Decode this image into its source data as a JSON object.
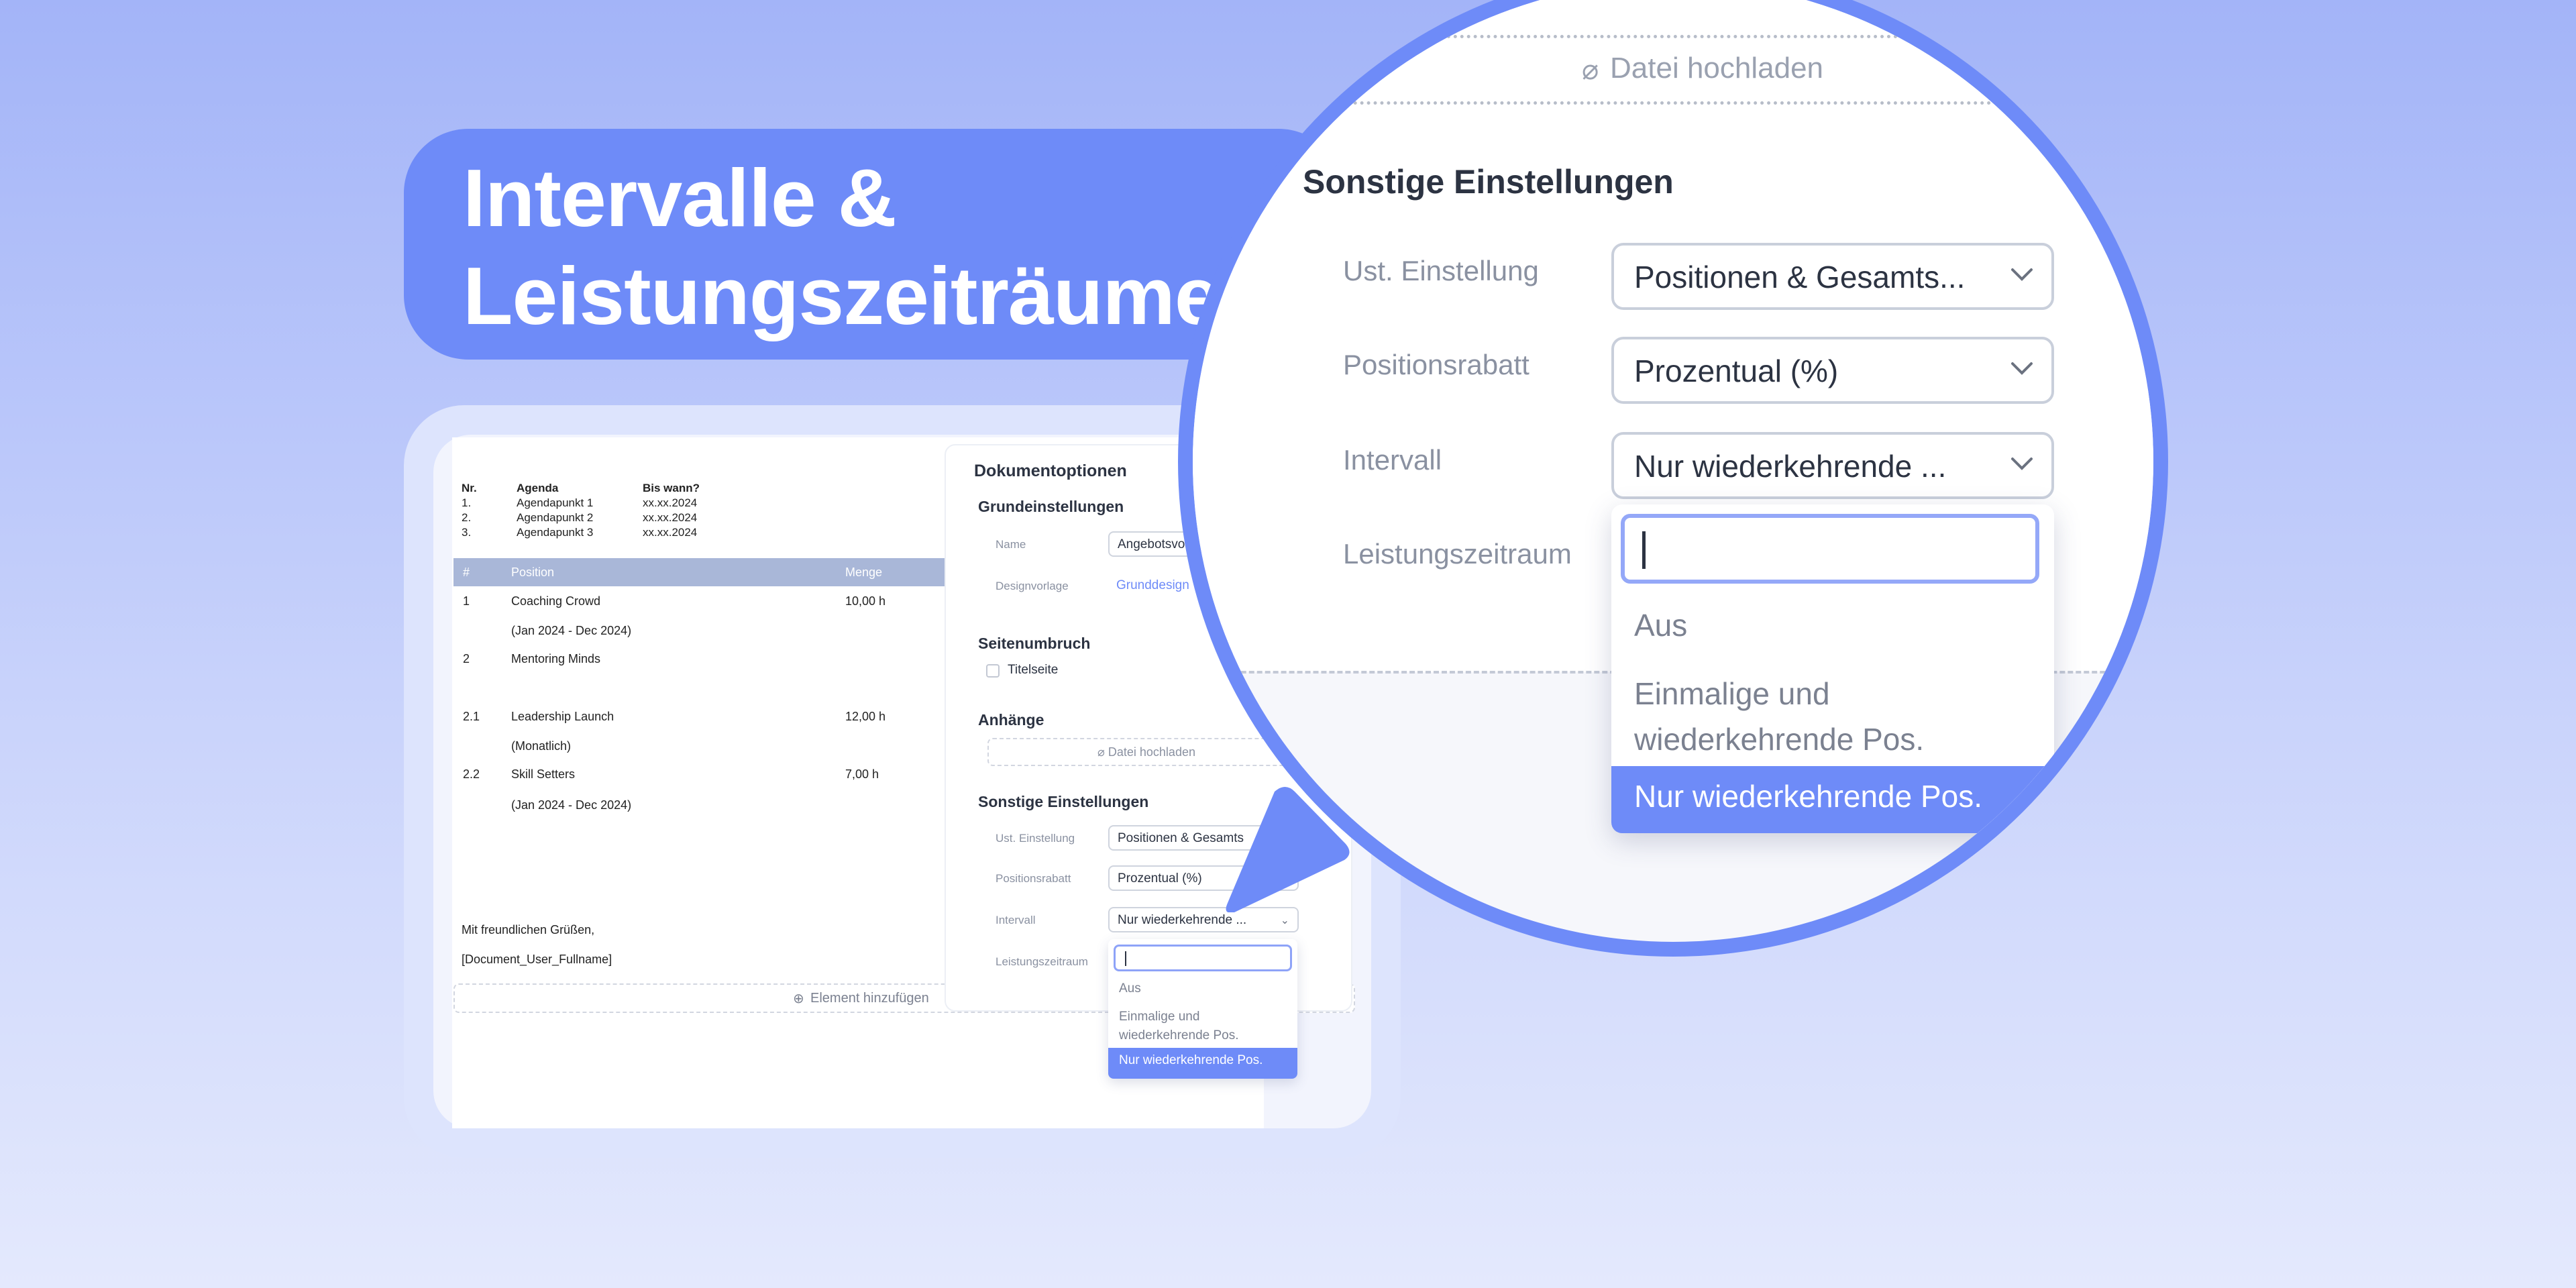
{
  "banner": {
    "title_line1": "Intervalle &",
    "title_line2": "Leistungszeiträume"
  },
  "document": {
    "agenda": {
      "headers": [
        "Nr.",
        "Agenda",
        "Bis wann?"
      ],
      "rows": [
        [
          "1.",
          "Agendapunkt 1",
          "xx.xx.2024"
        ],
        [
          "2.",
          "Agendapunkt 2",
          "xx.xx.2024"
        ],
        [
          "3.",
          "Agendapunkt 3",
          "xx.xx.2024"
        ]
      ]
    },
    "table_headers": [
      "#",
      "Position",
      "Menge"
    ],
    "rows": [
      {
        "nr": "1",
        "position": "Coaching Crowd",
        "menge": "10,00 h",
        "note": "(Jan 2024 - Dec 2024)"
      },
      {
        "nr": "2",
        "position": "Mentoring Minds",
        "menge": "",
        "note": ""
      },
      {
        "nr": "2.1",
        "position": "Leadership Launch",
        "menge": "12,00 h",
        "note": "(Monatlich)"
      },
      {
        "nr": "2.2",
        "position": "Skill Setters",
        "menge": "7,00 h",
        "note": "(Jan 2024 - Dec 2024)"
      }
    ],
    "closing": "Mit freundlichen Grüßen,",
    "signature": "[Document_User_Fullname]",
    "add_element": "Element hinzufügen"
  },
  "options": {
    "title": "Dokumentoptionen",
    "basic_title": "Grundeinstellungen",
    "name_label": "Name",
    "name_value": "Angebotsvor",
    "design_label": "Designvorlage",
    "design_value": "Grunddesign",
    "page_break_title": "Seitenumbruch",
    "title_page_label": "Titelseite",
    "attachments_title": "Anhänge",
    "upload_label": "Datei hochladen",
    "other_title": "Sonstige Einstellungen",
    "vat_label": "Ust. Einstellung",
    "vat_value": "Positionen & Gesamts",
    "discount_label": "Positionsrabatt",
    "discount_value": "Prozentual (%)",
    "interval_label": "Intervall",
    "interval_value": "Nur wiederkehrende ...",
    "period_label": "Leistungszeitraum",
    "dropdown_options": [
      "Aus",
      "Einmalige und",
      "wiederkehrende Pos.",
      "Nur wiederkehrende Pos."
    ]
  },
  "magnified": {
    "upload_label": "Datei hochladen",
    "other_title": "Sonstige Einstellungen",
    "vat_label": "Ust. Einstellung",
    "vat_value": "Positionen & Gesamts...",
    "discount_label": "Positionsrabatt",
    "discount_value": "Prozentual (%)",
    "interval_label": "Intervall",
    "interval_value": "Nur wiederkehrende ...",
    "period_label": "Leistungszeitraum",
    "dropdown_options": [
      "Aus",
      "Einmalige und",
      "wiederkehrende Pos.",
      "Nur wiederkehrende Pos."
    ]
  },
  "colors": {
    "accent": "#6e8bf8",
    "table_header": "#a9b7d8",
    "link": "#6e8bf8"
  }
}
